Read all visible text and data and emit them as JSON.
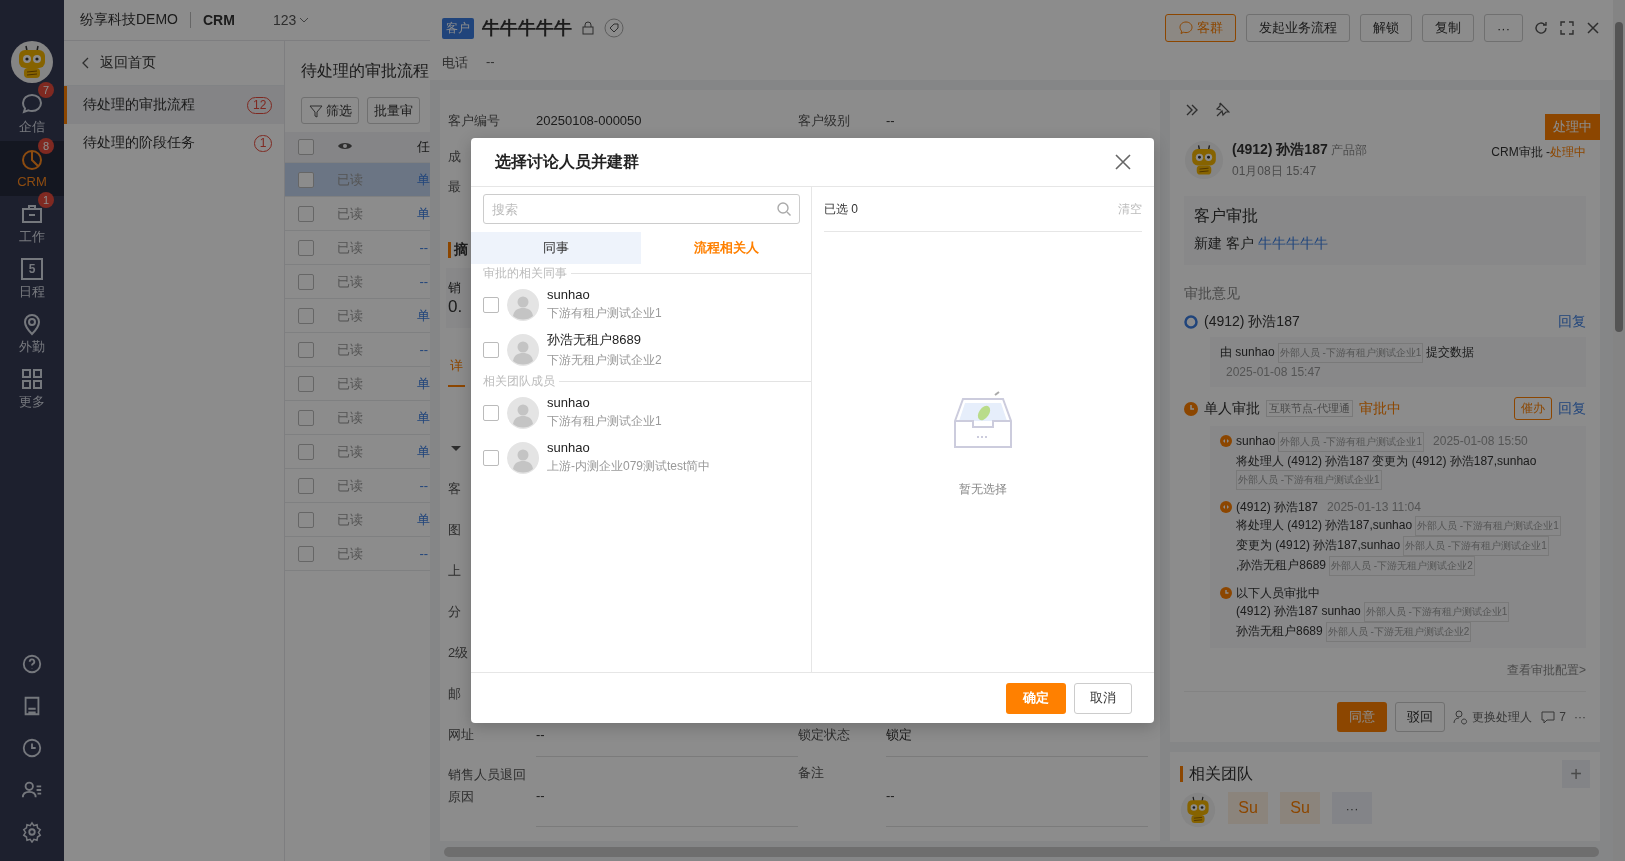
{
  "nav": {
    "items": [
      {
        "label": "企信",
        "badge": "7",
        "selected": false
      },
      {
        "label": "CRM",
        "badge": "8",
        "selected": true
      },
      {
        "label": "工作",
        "badge": "1",
        "selected": false
      },
      {
        "label": "日程",
        "day": "5",
        "selected": false
      },
      {
        "label": "外勤",
        "selected": false
      },
      {
        "label": "更多",
        "selected": false
      }
    ]
  },
  "header": {
    "company": "纷享科技DEMO",
    "app": "CRM",
    "account": "123"
  },
  "subnav": {
    "back": "返回首页",
    "items": [
      {
        "label": "待处理的审批流程",
        "count": "12",
        "selected": true
      },
      {
        "label": "待处理的阶段任务",
        "count": "1",
        "selected": false
      }
    ]
  },
  "list": {
    "title": "待处理的审批流程",
    "buttons": [
      "筛选",
      "批量审"
    ],
    "column_3": "任",
    "all_checked": false,
    "rows": [
      {
        "read": "已读",
        "column_3": "单",
        "selected": true
      },
      {
        "read": "已读",
        "column_3": "单",
        "selected": false
      },
      {
        "read": "已读",
        "column_3": "--",
        "selected": false
      },
      {
        "read": "已读",
        "column_3": "--",
        "selected": false
      },
      {
        "read": "已读",
        "column_3": "单",
        "selected": false
      },
      {
        "read": "已读",
        "column_3": "--",
        "selected": false
      },
      {
        "read": "已读",
        "column_3": "单",
        "selected": false
      },
      {
        "read": "已读",
        "column_3": "单",
        "selected": false
      },
      {
        "read": "已读",
        "column_3": "单",
        "selected": false
      },
      {
        "read": "已读",
        "column_3": "--",
        "selected": false
      },
      {
        "read": "已读",
        "column_3": "单",
        "selected": false
      },
      {
        "read": "已读",
        "column_3": "--",
        "selected": false
      }
    ]
  },
  "drawer": {
    "tag": "客户",
    "title": "牛牛牛牛牛",
    "actions": [
      {
        "label": "客群",
        "kind": "primary"
      },
      {
        "label": "发起业务流程",
        "kind": "default"
      },
      {
        "label": "解锁",
        "kind": "default"
      },
      {
        "label": "复制",
        "kind": "default"
      },
      {
        "label": "···",
        "kind": "default"
      }
    ],
    "phone_label": "电话",
    "phone_value": "--",
    "rows": [
      {
        "kind": "pair",
        "label": "客户编号",
        "value": "20250108-000050",
        "label2": "客户级别",
        "value2": "--"
      },
      {
        "kind": "label",
        "text": "成"
      },
      {
        "kind": "label",
        "text": "最"
      },
      {
        "kind": "section",
        "text": "摘"
      },
      {
        "kind": "stat",
        "text": "销",
        "value": "0."
      },
      {
        "kind": "tab",
        "text": "详"
      },
      {
        "kind": "caret"
      },
      {
        "kind": "label",
        "text": "客"
      },
      {
        "kind": "label",
        "text": "图"
      },
      {
        "kind": "label",
        "text": "上"
      },
      {
        "kind": "label",
        "text": "分"
      },
      {
        "kind": "label",
        "text": "2级"
      },
      {
        "kind": "label",
        "text": "邮"
      },
      {
        "kind": "pair",
        "label": "网址",
        "value": "--",
        "label2": "锁定状态",
        "value2": "锁定"
      },
      {
        "kind": "pair",
        "label": "销售人员退回原因",
        "value": "--",
        "label2": "备注",
        "value2": "--"
      }
    ]
  },
  "approval": {
    "status_badge": "处理中",
    "author": "(4912) 孙浩187",
    "dept": "产品部",
    "date": "01月08日 15:47",
    "flow": "CRM审批 - ",
    "flow_status": "处理中",
    "summary_title": "客户审批",
    "summary_text": "新建 客户",
    "summary_link": "牛牛牛牛牛",
    "opinions_title": "审批意见",
    "steps": [
      {
        "kind": "done",
        "title": "(4912) 孙浩187",
        "reply": "回复",
        "entries": [
          {
            "kind": "plain",
            "lines": [
              [
                {
                  "kind": "text",
                  "text": "由 sunhao"
                },
                {
                  "kind": "tag",
                  "text": "外部人员 -下游有租户测试企业1"
                },
                {
                  "kind": "text",
                  "text": "提交数据"
                },
                {
                  "kind": "time",
                  "text": "2025-01-08 15:47"
                }
              ]
            ]
          }
        ]
      },
      {
        "kind": "pending",
        "title": "单人审批",
        "tag": "互联节点-代理通",
        "status": "审批中",
        "urge": "催办",
        "reply": "回复",
        "entries": [
          {
            "kind": "transfer",
            "lines": [
              [
                {
                  "kind": "text",
                  "text": "sunhao"
                },
                {
                  "kind": "tag",
                  "text": "外部人员 -下游有租户测试企业1"
                },
                {
                  "kind": "time",
                  "text": "2025-01-08 15:50"
                }
              ],
              [
                {
                  "kind": "text",
                  "text": "将处理人 (4912) 孙浩187"
                },
                {
                  "kind": "text",
                  "text": "变更为 (4912) 孙浩187,sunhao"
                },
                {
                  "kind": "tag",
                  "text": "外部人员 -下游有租户测试企业1"
                }
              ]
            ]
          },
          {
            "kind": "transfer",
            "lines": [
              [
                {
                  "kind": "text",
                  "text": "(4912) 孙浩187"
                },
                {
                  "kind": "time",
                  "text": "2025-01-13 11:04"
                }
              ],
              [
                {
                  "kind": "text",
                  "text": "将处理人 (4912) 孙浩187,sunhao"
                },
                {
                  "kind": "tag",
                  "text": "外部人员 -下游有租户测试企业1"
                },
                {
                  "kind": "text",
                  "text": "变更为 (4912) 孙浩187,sunhao"
                },
                {
                  "kind": "tag",
                  "text": "外部人员 -下游有租户测试企业1"
                },
                {
                  "kind": "text",
                  "text": ",孙浩无租户8689"
                },
                {
                  "kind": "tag",
                  "text": "外部人员 -下游无租户测试企业2"
                }
              ]
            ]
          },
          {
            "kind": "waiting",
            "lines": [
              [
                {
                  "kind": "text",
                  "text": "以下人员审批中"
                }
              ],
              [
                {
                  "kind": "text",
                  "text": "(4912) 孙浩187 sunhao"
                },
                {
                  "kind": "tag",
                  "text": "外部人员 -下游有租户测试企业1"
                },
                {
                  "kind": "text",
                  "text": "孙浩无租户8689"
                },
                {
                  "kind": "tag",
                  "text": "外部人员 -下游无租户测试企业2"
                }
              ]
            ]
          }
        ]
      }
    ],
    "config_link": "查看审批配置>",
    "approve": "同意",
    "reject": "驳回",
    "reassign": "更换处理人",
    "comments": "7",
    "more": "···"
  },
  "team": {
    "title": "相关团队",
    "add": "+",
    "members": [
      {
        "kind": "robot"
      },
      {
        "kind": "initials",
        "text": "Su"
      },
      {
        "kind": "initials",
        "text": "Su"
      },
      {
        "kind": "more",
        "text": "···"
      }
    ]
  },
  "modal": {
    "title": "选择讨论人员并建群",
    "search": {
      "placeholder": "搜索"
    },
    "tabs": [
      {
        "label": "同事",
        "selected": false
      },
      {
        "label": "流程相关人",
        "selected": true
      }
    ],
    "groups": [
      {
        "title": "审批的相关同事",
        "people": [
          {
            "name": "sunhao",
            "org": "下游有租户测试企业1",
            "checked": false
          },
          {
            "name": "孙浩无租户8689",
            "org": "下游无租户测试企业2",
            "checked": false
          }
        ]
      },
      {
        "title": "相关团队成员",
        "people": [
          {
            "name": "sunhao",
            "org": "下游有租户测试企业1",
            "checked": false
          },
          {
            "name": "sunhao",
            "org": "上游-内测企业079测试test简中",
            "checked": false
          }
        ]
      }
    ],
    "selected_label": "已选 0",
    "clear": "清空",
    "empty": "暂无选择",
    "confirm": "确定",
    "cancel": "取消"
  }
}
